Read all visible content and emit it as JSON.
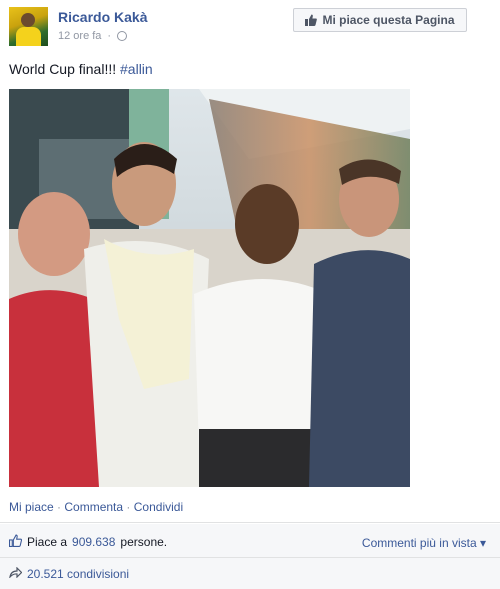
{
  "post": {
    "author": "Ricardo Kakà",
    "timestamp": "12 ore fa",
    "privacy_icon": "globe-icon",
    "like_page_button": "Mi piace questa Pagina",
    "text_main": "World Cup final!!! ",
    "hashtag": "#allin",
    "actions": {
      "like": "Mi piace",
      "comment": "Commenta",
      "share": "Condividi",
      "separator": "·"
    },
    "likes": {
      "prefix": "Piace a",
      "count": "909.638",
      "suffix": "persone."
    },
    "comments_sort": "Commenti più in vista ▾",
    "shares": "20.521 condivisioni"
  },
  "colors": {
    "link_blue": "#3b5998",
    "text": "#141823",
    "muted": "#9197a3",
    "row_bg": "#f6f7f9"
  }
}
